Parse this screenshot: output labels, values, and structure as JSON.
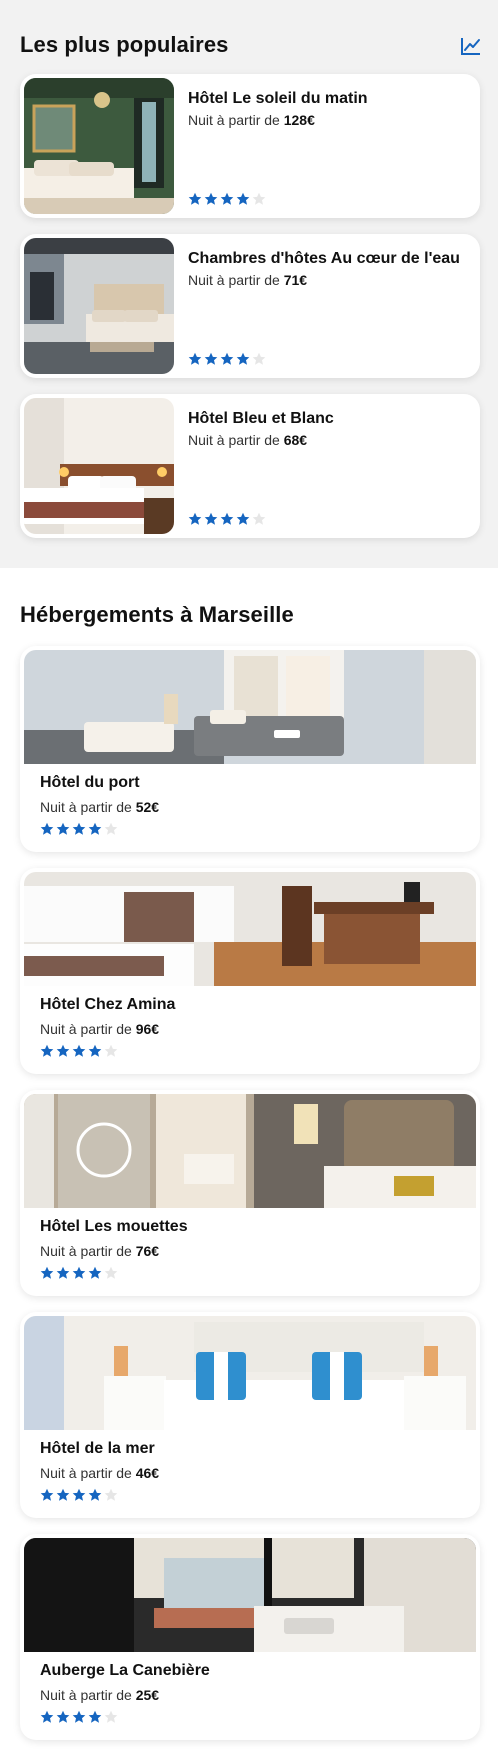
{
  "popular": {
    "title": "Les plus populaires",
    "trend_icon": "chart-line-icon",
    "items": [
      {
        "name": "Hôtel Le soleil du matin",
        "price_prefix": "Nuit à partir de",
        "price": "128€",
        "rating": 4,
        "max_rating": 5
      },
      {
        "name": "Chambres d'hôtes Au cœur de l'eau",
        "price_prefix": "Nuit à partir de",
        "price": "71€",
        "rating": 4,
        "max_rating": 5
      },
      {
        "name": "Hôtel Bleu et Blanc",
        "price_prefix": "Nuit à partir de",
        "price": "68€",
        "rating": 4,
        "max_rating": 5
      }
    ]
  },
  "accommodations": {
    "title": "Hébergements à Marseille",
    "items": [
      {
        "name": "Hôtel du port",
        "price_prefix": "Nuit à partir de",
        "price": "52€",
        "rating": 4,
        "max_rating": 5
      },
      {
        "name": "Hôtel Chez Amina",
        "price_prefix": "Nuit à partir de",
        "price": "96€",
        "rating": 4,
        "max_rating": 5
      },
      {
        "name": "Hôtel Les mouettes",
        "price_prefix": "Nuit à partir de",
        "price": "76€",
        "rating": 4,
        "max_rating": 5
      },
      {
        "name": "Hôtel de la mer",
        "price_prefix": "Nuit à partir de",
        "price": "46€",
        "rating": 4,
        "max_rating": 5
      },
      {
        "name": "Auberge La Canebière",
        "price_prefix": "Nuit à partir de",
        "price": "25€",
        "rating": 4,
        "max_rating": 5
      }
    ]
  },
  "colors": {
    "accent": "#1565c0",
    "star_filled": "#1565c0",
    "star_empty": "#e6e6e6",
    "section_bg": "#f2f2f2"
  }
}
